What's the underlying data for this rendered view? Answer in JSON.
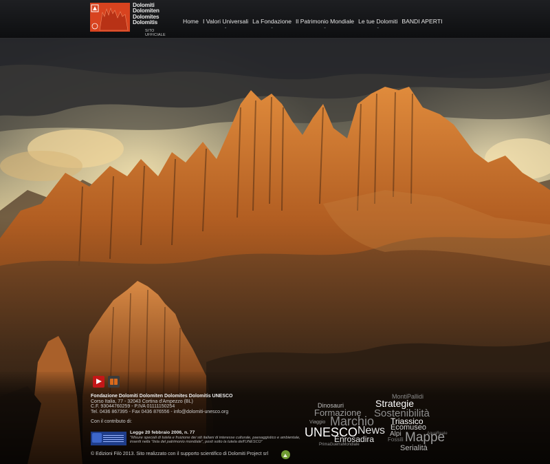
{
  "header": {
    "logo": {
      "lines": [
        "Dolomiti",
        "Dolomiten",
        "Dolomites",
        "Dolomitis"
      ],
      "subtitle": "SITO UFFICIALE"
    },
    "nav": [
      {
        "label": "Home"
      },
      {
        "label": "I Valori Universali"
      },
      {
        "label": "La Fondazione"
      },
      {
        "label": "Il Patrimonio Mondiale"
      },
      {
        "label": "Le tue Dolomiti"
      },
      {
        "label": "BANDI APERTI"
      }
    ]
  },
  "colors": {
    "brand_orange": "#d8431f",
    "header_bg": "#131417",
    "text_light": "#e6e6e6"
  },
  "footer": {
    "social": [
      {
        "icon": "youtube-icon"
      },
      {
        "icon": "book-icon"
      }
    ],
    "organization": "Fondazione Dolomiti Dolomiten Dolomites Dolomitis UNESCO",
    "address": "Corso Italia, 77 - 32043 Cortina d'Ampezzo (BL)",
    "tax": "C.F. 93044760259 - P.IVA 01111150254",
    "contact": "Tel. 0436 867395 - Fax 0436 876556 - info@dolomiti-unesco.org",
    "contribution": "Con il contributo di:",
    "law": {
      "title": "Legge 20 febbraio 2006, n. 77",
      "text": "\"Misure speciali di tutela e fruizione dei siti italiani di interesse culturale, paesaggistico e ambientale, inseriti nella \"lista del patrimonio mondiale\", posti sotto la tutela dell'UNESCO\""
    },
    "copyright": "© Edizioni Filò 2013. Sito realizzato con il supporto scientifico di Dolomiti Project srl"
  },
  "tag_cloud": [
    {
      "text": "MontiPallidi"
    },
    {
      "text": "Strategie"
    },
    {
      "text": "Dinosauri"
    },
    {
      "text": "Formazione"
    },
    {
      "text": "Sostenibilità"
    },
    {
      "text": "Triassico"
    },
    {
      "text": "Viaggio"
    },
    {
      "text": "Marchio"
    },
    {
      "text": "Ecomuseo"
    },
    {
      "text": "UNESCO"
    },
    {
      "text": "News"
    },
    {
      "text": "AquaReale"
    },
    {
      "text": "Alpi"
    },
    {
      "text": "Enrosadira"
    },
    {
      "text": "Fossili"
    },
    {
      "text": "Mappe"
    },
    {
      "text": "PrimaGuerraMondiale"
    },
    {
      "text": "Serialità"
    }
  ]
}
